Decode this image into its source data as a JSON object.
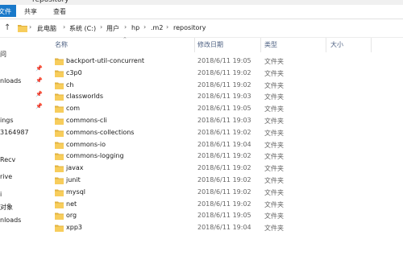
{
  "window": {
    "title": "repository"
  },
  "ribbon": {
    "tabs": [
      "文件",
      "共享",
      "查看"
    ]
  },
  "address": {
    "crumbs": [
      "此电脑",
      "系统 (C:)",
      "用户",
      "hp",
      ".m2",
      "repository"
    ]
  },
  "columns": {
    "name": "名称",
    "date": "修改日期",
    "type": "类型",
    "size": "大小"
  },
  "sidebar": {
    "items": [
      "问",
      "nloads",
      "ings",
      "3164987",
      "Recv",
      "rive",
      "i",
      "对象",
      "nloads"
    ]
  },
  "files": [
    {
      "name": "backport-util-concurrent",
      "date": "2018/6/11 19:05",
      "type": "文件夹"
    },
    {
      "name": "c3p0",
      "date": "2018/6/11 19:02",
      "type": "文件夹"
    },
    {
      "name": "ch",
      "date": "2018/6/11 19:02",
      "type": "文件夹"
    },
    {
      "name": "classworlds",
      "date": "2018/6/11 19:03",
      "type": "文件夹"
    },
    {
      "name": "com",
      "date": "2018/6/11 19:05",
      "type": "文件夹"
    },
    {
      "name": "commons-cli",
      "date": "2018/6/11 19:03",
      "type": "文件夹"
    },
    {
      "name": "commons-collections",
      "date": "2018/6/11 19:02",
      "type": "文件夹"
    },
    {
      "name": "commons-io",
      "date": "2018/6/11 19:04",
      "type": "文件夹"
    },
    {
      "name": "commons-logging",
      "date": "2018/6/11 19:02",
      "type": "文件夹"
    },
    {
      "name": "javax",
      "date": "2018/6/11 19:02",
      "type": "文件夹"
    },
    {
      "name": "junit",
      "date": "2018/6/11 19:02",
      "type": "文件夹"
    },
    {
      "name": "mysql",
      "date": "2018/6/11 19:02",
      "type": "文件夹"
    },
    {
      "name": "net",
      "date": "2018/6/11 19:02",
      "type": "文件夹"
    },
    {
      "name": "org",
      "date": "2018/6/11 19:05",
      "type": "文件夹"
    },
    {
      "name": "xpp3",
      "date": "2018/6/11 19:04",
      "type": "文件夹"
    }
  ]
}
